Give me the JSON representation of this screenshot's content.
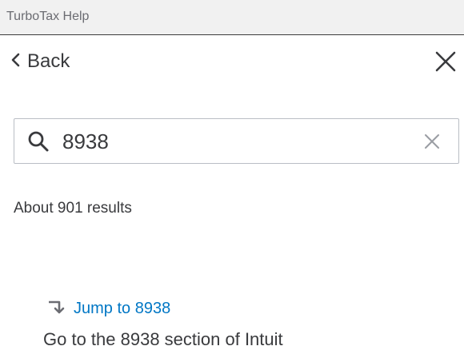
{
  "window": {
    "title": "TurboTax Help"
  },
  "nav": {
    "back_label": "Back"
  },
  "search": {
    "value": "8938",
    "placeholder": ""
  },
  "results": {
    "count_text": "About 901 results",
    "items": [
      {
        "link_text": "Jump to 8938",
        "description": "Go to the 8938 section of Intuit"
      }
    ]
  },
  "colors": {
    "link": "#0077c5",
    "text": "#393a3d",
    "titlebar_bg": "#f1f1f1",
    "input_border": "#babec5"
  },
  "icons": {
    "back": "chevron-left-icon",
    "close": "close-icon",
    "search": "search-icon",
    "clear": "clear-icon",
    "jump": "jump-arrow-icon"
  }
}
